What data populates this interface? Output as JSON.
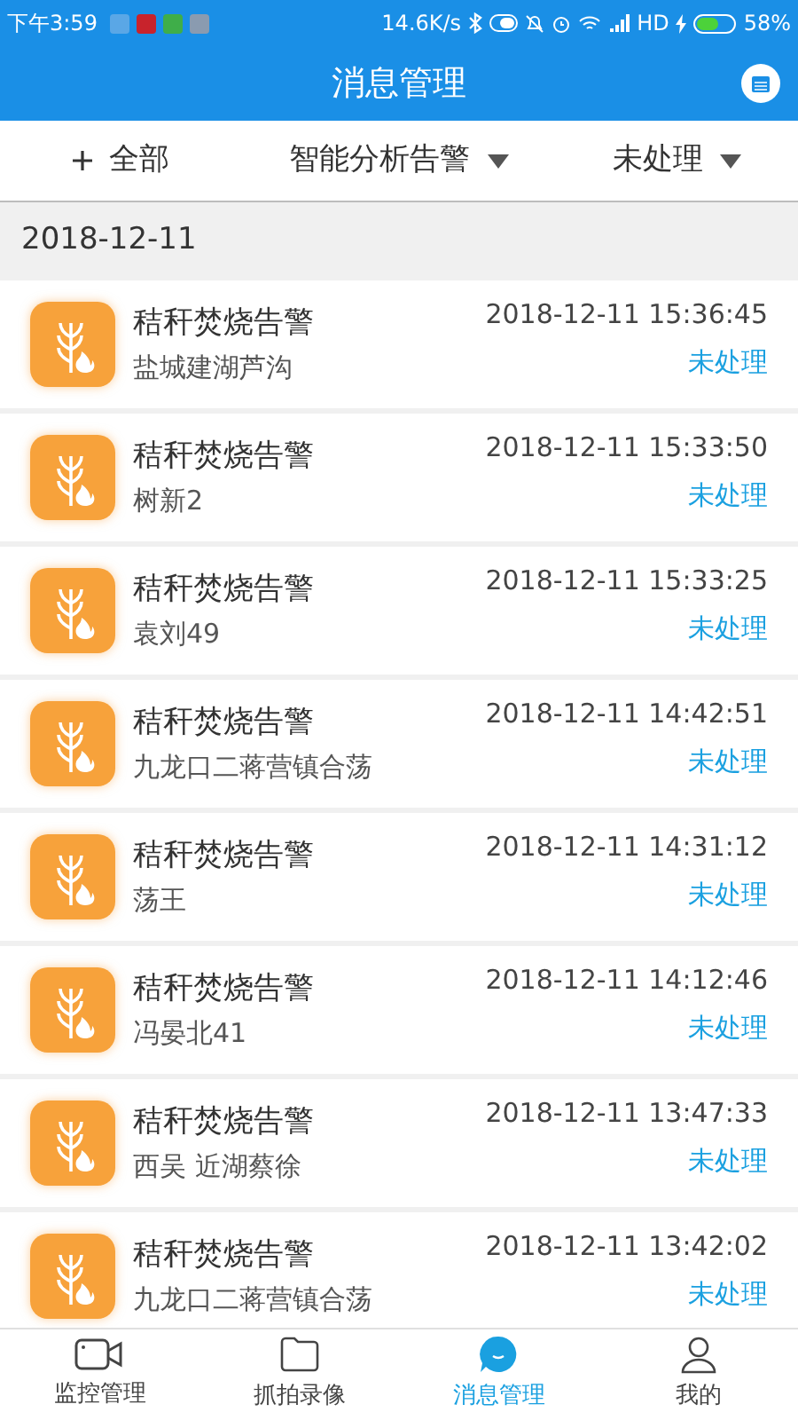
{
  "status_bar": {
    "time": "下午3:59",
    "speed": "14.6K/s",
    "network": "HD",
    "battery": "58%"
  },
  "header": {
    "title": "消息管理"
  },
  "filters": [
    {
      "kind": "add",
      "label": "全部"
    },
    {
      "kind": "dropdown",
      "label": "智能分析告警"
    },
    {
      "kind": "dropdown",
      "label": "未处理"
    }
  ],
  "date_group": "2018-12-11",
  "messages": [
    {
      "title": "秸秆焚烧告警",
      "place": "盐城建湖芦沟",
      "time": "2018-12-11 15:36:45",
      "status": "未处理"
    },
    {
      "title": "秸秆焚烧告警",
      "place": "树新2",
      "time": "2018-12-11 15:33:50",
      "status": "未处理"
    },
    {
      "title": "秸秆焚烧告警",
      "place": "袁刘49",
      "time": "2018-12-11 15:33:25",
      "status": "未处理"
    },
    {
      "title": "秸秆焚烧告警",
      "place": "九龙口二蒋营镇合荡",
      "time": "2018-12-11 14:42:51",
      "status": "未处理"
    },
    {
      "title": "秸秆焚烧告警",
      "place": "荡王",
      "time": "2018-12-11 14:31:12",
      "status": "未处理"
    },
    {
      "title": "秸秆焚烧告警",
      "place": "冯晏北41",
      "time": "2018-12-11 14:12:46",
      "status": "未处理"
    },
    {
      "title": "秸秆焚烧告警",
      "place": "西吴 近湖蔡徐",
      "time": "2018-12-11 13:47:33",
      "status": "未处理"
    },
    {
      "title": "秸秆焚烧告警",
      "place": "九龙口二蒋营镇合荡",
      "time": "2018-12-11 13:42:02",
      "status": "未处理"
    }
  ],
  "nav": [
    {
      "kind": "camera",
      "label": "监控管理",
      "selected": false
    },
    {
      "kind": "folder",
      "label": "抓拍录像",
      "selected": false
    },
    {
      "kind": "message",
      "label": "消息管理",
      "selected": true
    },
    {
      "kind": "person",
      "label": "我的",
      "selected": false
    }
  ]
}
